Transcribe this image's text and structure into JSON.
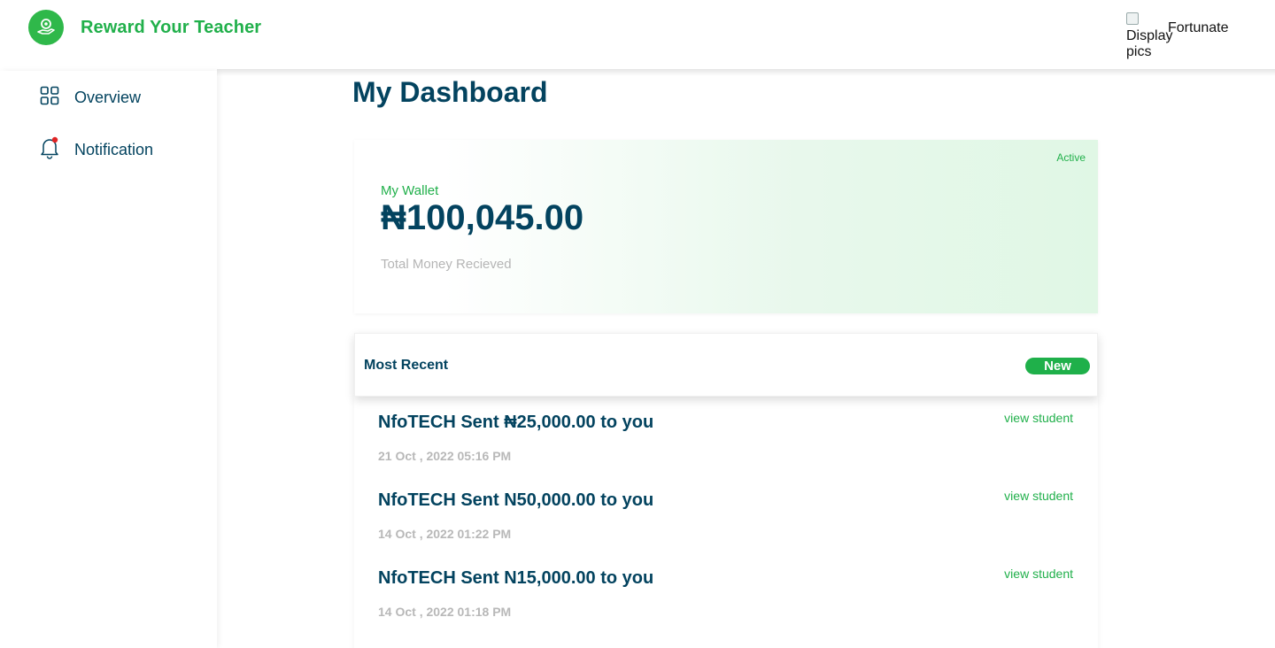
{
  "header": {
    "app_name": "Reward Your Teacher",
    "avatar_alt": "Display pics",
    "username": "Fortunate"
  },
  "sidebar": {
    "items": [
      {
        "label": "Overview",
        "icon": "grid-icon"
      },
      {
        "label": "Notification",
        "icon": "bell-icon"
      }
    ]
  },
  "main": {
    "title": "My Dashboard",
    "wallet": {
      "status": "Active",
      "label": "My Wallet",
      "amount": "₦100,045.00",
      "subtitle": "Total Money Recieved"
    },
    "recent": {
      "title": "Most Recent",
      "badge": "New",
      "items": [
        {
          "message": "NfoTECH Sent ₦25,000.00 to you",
          "date": "21 Oct , 2022 05:16 PM",
          "link": "view student"
        },
        {
          "message": "NfoTECH Sent N50,000.00 to you",
          "date": "14 Oct , 2022 01:22 PM",
          "link": "view student"
        },
        {
          "message": "NfoTECH Sent N15,000.00 to you",
          "date": "14 Oct , 2022 01:18 PM",
          "link": "view student"
        }
      ]
    }
  },
  "colors": {
    "brand_green": "#21b04b",
    "navy": "#03435f",
    "muted": "#b5b5b5",
    "notification_dot": "#e02424"
  }
}
